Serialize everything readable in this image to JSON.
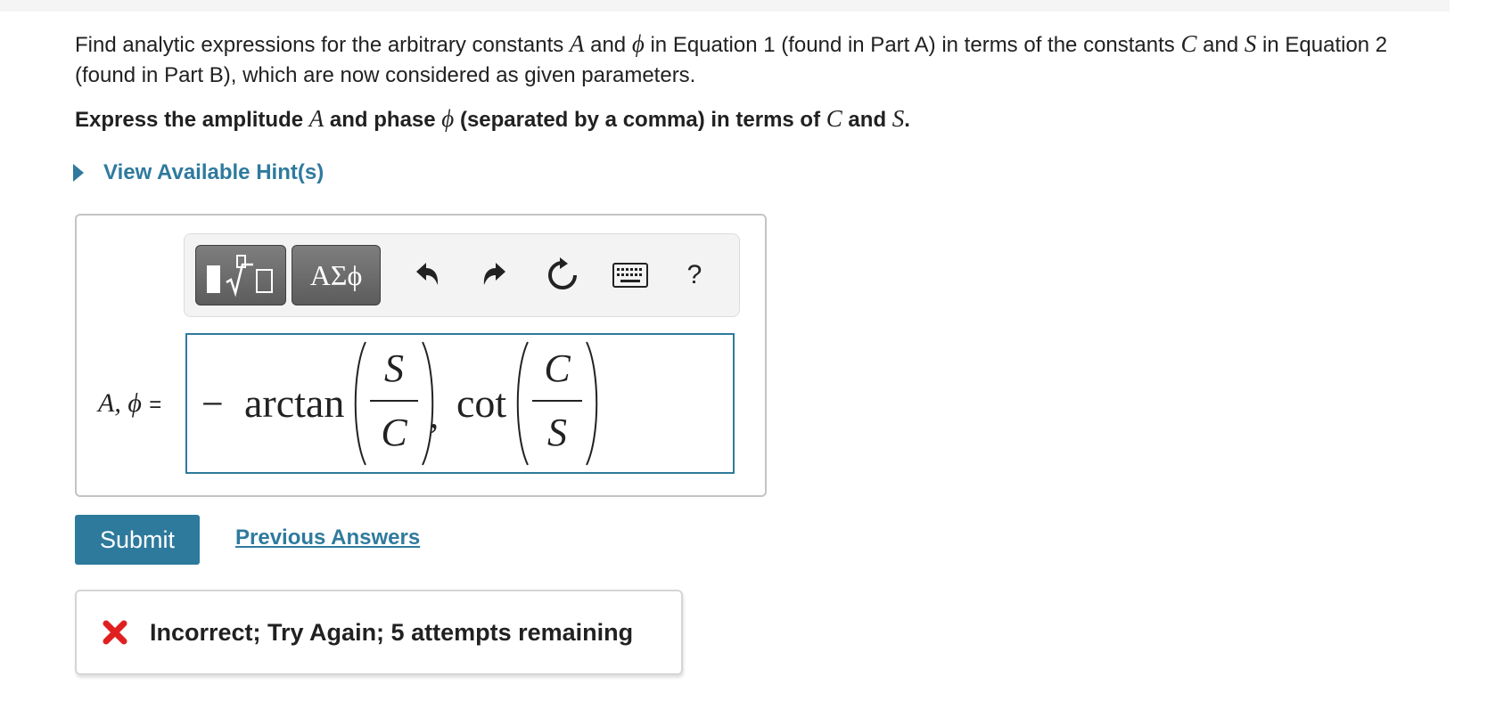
{
  "question": {
    "prompt_parts": [
      "Find analytic expressions for the arbitrary constants ",
      "A",
      " and ",
      "ϕ",
      " in Equation 1 (found in Part A) in terms of the constants ",
      "C",
      " and ",
      "S",
      " in Equation 2 (found in Part B), which are now considered as given parameters."
    ],
    "instruction_parts": [
      "Express the amplitude ",
      "A",
      " and phase ",
      "ϕ",
      " (separated by a comma) in terms of ",
      "C",
      " and ",
      "S",
      "."
    ]
  },
  "hint": {
    "label": "View Available Hint(s)"
  },
  "toolbar": {
    "templates_icon": "fraction-root-template-icon",
    "symbols_label": "ΑΣϕ",
    "undo_icon": "undo-icon",
    "redo_icon": "redo-icon",
    "reset_icon": "reset-icon",
    "keyboard_icon": "keyboard-icon",
    "help_label": "?"
  },
  "answer": {
    "variable_label": "A, ϕ",
    "equals": "=",
    "expression": {
      "minus": "−",
      "func1": "arctan",
      "frac1_num": "S",
      "frac1_den": "C",
      "comma": ",",
      "func2": "cot",
      "frac2_num": "C",
      "frac2_den": "S"
    }
  },
  "actions": {
    "submit_label": "Submit",
    "previous_answers_label": "Previous Answers"
  },
  "feedback": {
    "icon": "x-mark-icon",
    "message": "Incorrect; Try Again; 5 attempts remaining"
  },
  "colors": {
    "accent": "#2f7a9e",
    "submit_bg": "#2e7a9c",
    "error": "#e02020",
    "toolbar_button": "#6a6a6a"
  }
}
